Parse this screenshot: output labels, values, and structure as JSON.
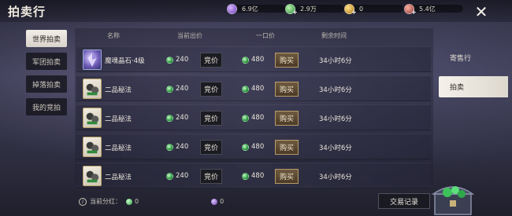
{
  "header": {
    "title": "拍卖行"
  },
  "currencies": [
    {
      "icon": "purple-gem-icon",
      "amount": "6.9亿",
      "has_plus": false
    },
    {
      "icon": "green-gem-icon",
      "amount": "2.9万",
      "has_plus": true
    },
    {
      "icon": "gold-coin-icon",
      "amount": "0",
      "has_plus": true
    },
    {
      "icon": "red-coin-icon",
      "amount": "5.4亿",
      "has_plus": true
    }
  ],
  "left_tabs": [
    {
      "label": "世界拍卖",
      "active": true
    },
    {
      "label": "军团拍卖",
      "active": false
    },
    {
      "label": "掉落拍卖",
      "active": false
    },
    {
      "label": "我的竞拍",
      "active": false
    }
  ],
  "columns": {
    "name": "名称",
    "current_bid": "当前出价",
    "buyout": "一口价",
    "remaining": "剩余时间"
  },
  "items": [
    {
      "name": "魔魂晶石·4级",
      "icon": "crystal",
      "bid": "240",
      "buyout": "480",
      "time": "34小时6分",
      "bid_label": "竞价",
      "buy_label": "购买"
    },
    {
      "name": "二品秘法",
      "icon": "scroll",
      "bid": "240",
      "buyout": "480",
      "time": "34小时6分",
      "bid_label": "竞价",
      "buy_label": "购买"
    },
    {
      "name": "二品秘法",
      "icon": "scroll",
      "bid": "240",
      "buyout": "480",
      "time": "34小时6分",
      "bid_label": "竞价",
      "buy_label": "购买"
    },
    {
      "name": "二品秘法",
      "icon": "scroll",
      "bid": "240",
      "buyout": "480",
      "time": "34小时6分",
      "bid_label": "竞价",
      "buy_label": "购买"
    },
    {
      "name": "二品秘法",
      "icon": "scroll",
      "bid": "240",
      "buyout": "480",
      "time": "34小时6分",
      "bid_label": "竞价",
      "buy_label": "购买"
    }
  ],
  "right_tabs": [
    {
      "label": "寄售行",
      "active": false
    },
    {
      "label": "拍卖",
      "active": true
    }
  ],
  "footer": {
    "dividend_label": "当前分红：",
    "green_value": "0",
    "purple_value": "0",
    "history_button": "交易记录"
  },
  "colors": {
    "accent_gold": "#b69b6a",
    "active_tab": "#f1eee8",
    "gem_green": "#2f9c44"
  }
}
